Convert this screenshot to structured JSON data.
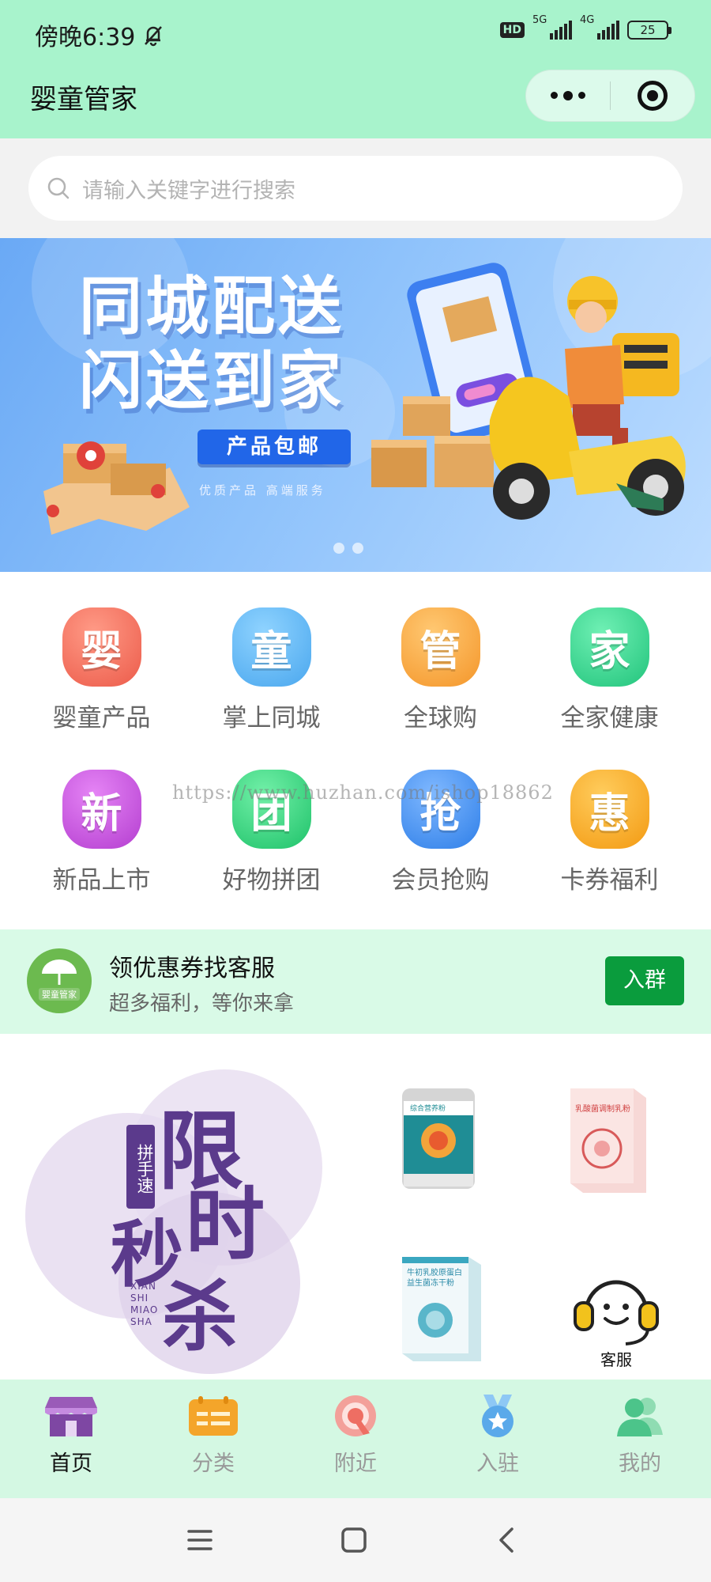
{
  "status_bar": {
    "time": "傍晚6:39",
    "hd": "HD",
    "network_1": "5G",
    "network_2": "4G",
    "battery": "25"
  },
  "header": {
    "title": "婴童管家"
  },
  "search": {
    "placeholder": "请输入关键字进行搜索"
  },
  "banner": {
    "title_line1": "同城配送",
    "title_line2": "闪送到家",
    "tag": "产品包邮",
    "subtitle": "优质产品   高端服务",
    "slide_count": 2
  },
  "grid": {
    "items": [
      {
        "icon_char": "婴",
        "label": "婴童产品",
        "color": "#f0685a"
      },
      {
        "icon_char": "童",
        "label": "掌上同城",
        "color": "#5db7f2"
      },
      {
        "icon_char": "管",
        "label": "全球购",
        "color": "#f6a33a"
      },
      {
        "icon_char": "家",
        "label": "全家健康",
        "color": "#2fcf8a"
      },
      {
        "icon_char": "新",
        "label": "新品上市",
        "color": "#c24fdb"
      },
      {
        "icon_char": "团",
        "label": "好物拼团",
        "color": "#2fcf7c"
      },
      {
        "icon_char": "抢",
        "label": "会员抢购",
        "color": "#3e8ff0"
      },
      {
        "icon_char": "惠",
        "label": "卡券福利",
        "color": "#f6a21d"
      }
    ],
    "watermark": "https://www.huzhan.com/ishop18862"
  },
  "coupon": {
    "logo_text": "婴童管家",
    "title": "领优惠券找客服",
    "subtitle": "超多福利，等你来拿",
    "button": "入群"
  },
  "promo": {
    "tag": "拼手速",
    "big_1": "限",
    "big_2": "时",
    "big_3": "秒",
    "big_4": "杀",
    "pinyin": "XIAN SHI MIAO SHA",
    "products": [
      {
        "label": "综合营养粉"
      },
      {
        "label": "乳酸菌调制乳粉"
      },
      {
        "label": "牛初乳胶原蛋白益生菌冻干粉"
      }
    ],
    "customer_service": "客服"
  },
  "tabbar": {
    "items": [
      {
        "label": "首页",
        "icon": "shop-icon",
        "active": true
      },
      {
        "label": "分类",
        "icon": "category-icon",
        "active": false
      },
      {
        "label": "附近",
        "icon": "nearby-icon",
        "active": false
      },
      {
        "label": "入驻",
        "icon": "medal-icon",
        "active": false
      },
      {
        "label": "我的",
        "icon": "user-icon",
        "active": false
      }
    ]
  },
  "colors": {
    "header_bg": "#a8f3cc",
    "tabbar_bg": "#d4f8e3",
    "coupon_bg": "#d9fae7",
    "accent_green": "#0a9c3d",
    "promo_purple": "#5b3a8c"
  }
}
